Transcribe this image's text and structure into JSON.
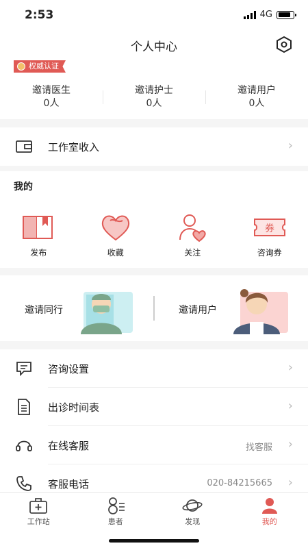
{
  "status": {
    "time": "2:53",
    "network": "4G"
  },
  "header": {
    "title": "个人中心",
    "badge": "权威认证",
    "stats": [
      {
        "label": "邀请医生",
        "value": "0人"
      },
      {
        "label": "邀请护士",
        "value": "0人"
      },
      {
        "label": "邀请用户",
        "value": "0人"
      }
    ]
  },
  "income": {
    "label": "工作室收入"
  },
  "mine": {
    "title": "我的",
    "items": [
      {
        "label": "发布",
        "icon": "book-icon"
      },
      {
        "label": "收藏",
        "icon": "heart-icon"
      },
      {
        "label": "关注",
        "icon": "follow-icon"
      },
      {
        "label": "咨询券",
        "icon": "coupon-icon",
        "coupon_glyph": "券"
      }
    ]
  },
  "invite": {
    "peer": "邀请同行",
    "user": "邀请用户"
  },
  "list": [
    {
      "label": "咨询设置",
      "extra": ""
    },
    {
      "label": "出诊时间表",
      "extra": ""
    },
    {
      "label": "在线客服",
      "extra": "找客服"
    },
    {
      "label": "客服电话",
      "extra": "020-84215665"
    }
  ],
  "tabs": [
    {
      "label": "工作站",
      "icon": "workstation-icon"
    },
    {
      "label": "患者",
      "icon": "patients-icon"
    },
    {
      "label": "发现",
      "icon": "planet-icon"
    },
    {
      "label": "我的",
      "icon": "person-icon",
      "active": true
    }
  ],
  "colors": {
    "accent": "#e05a55"
  }
}
